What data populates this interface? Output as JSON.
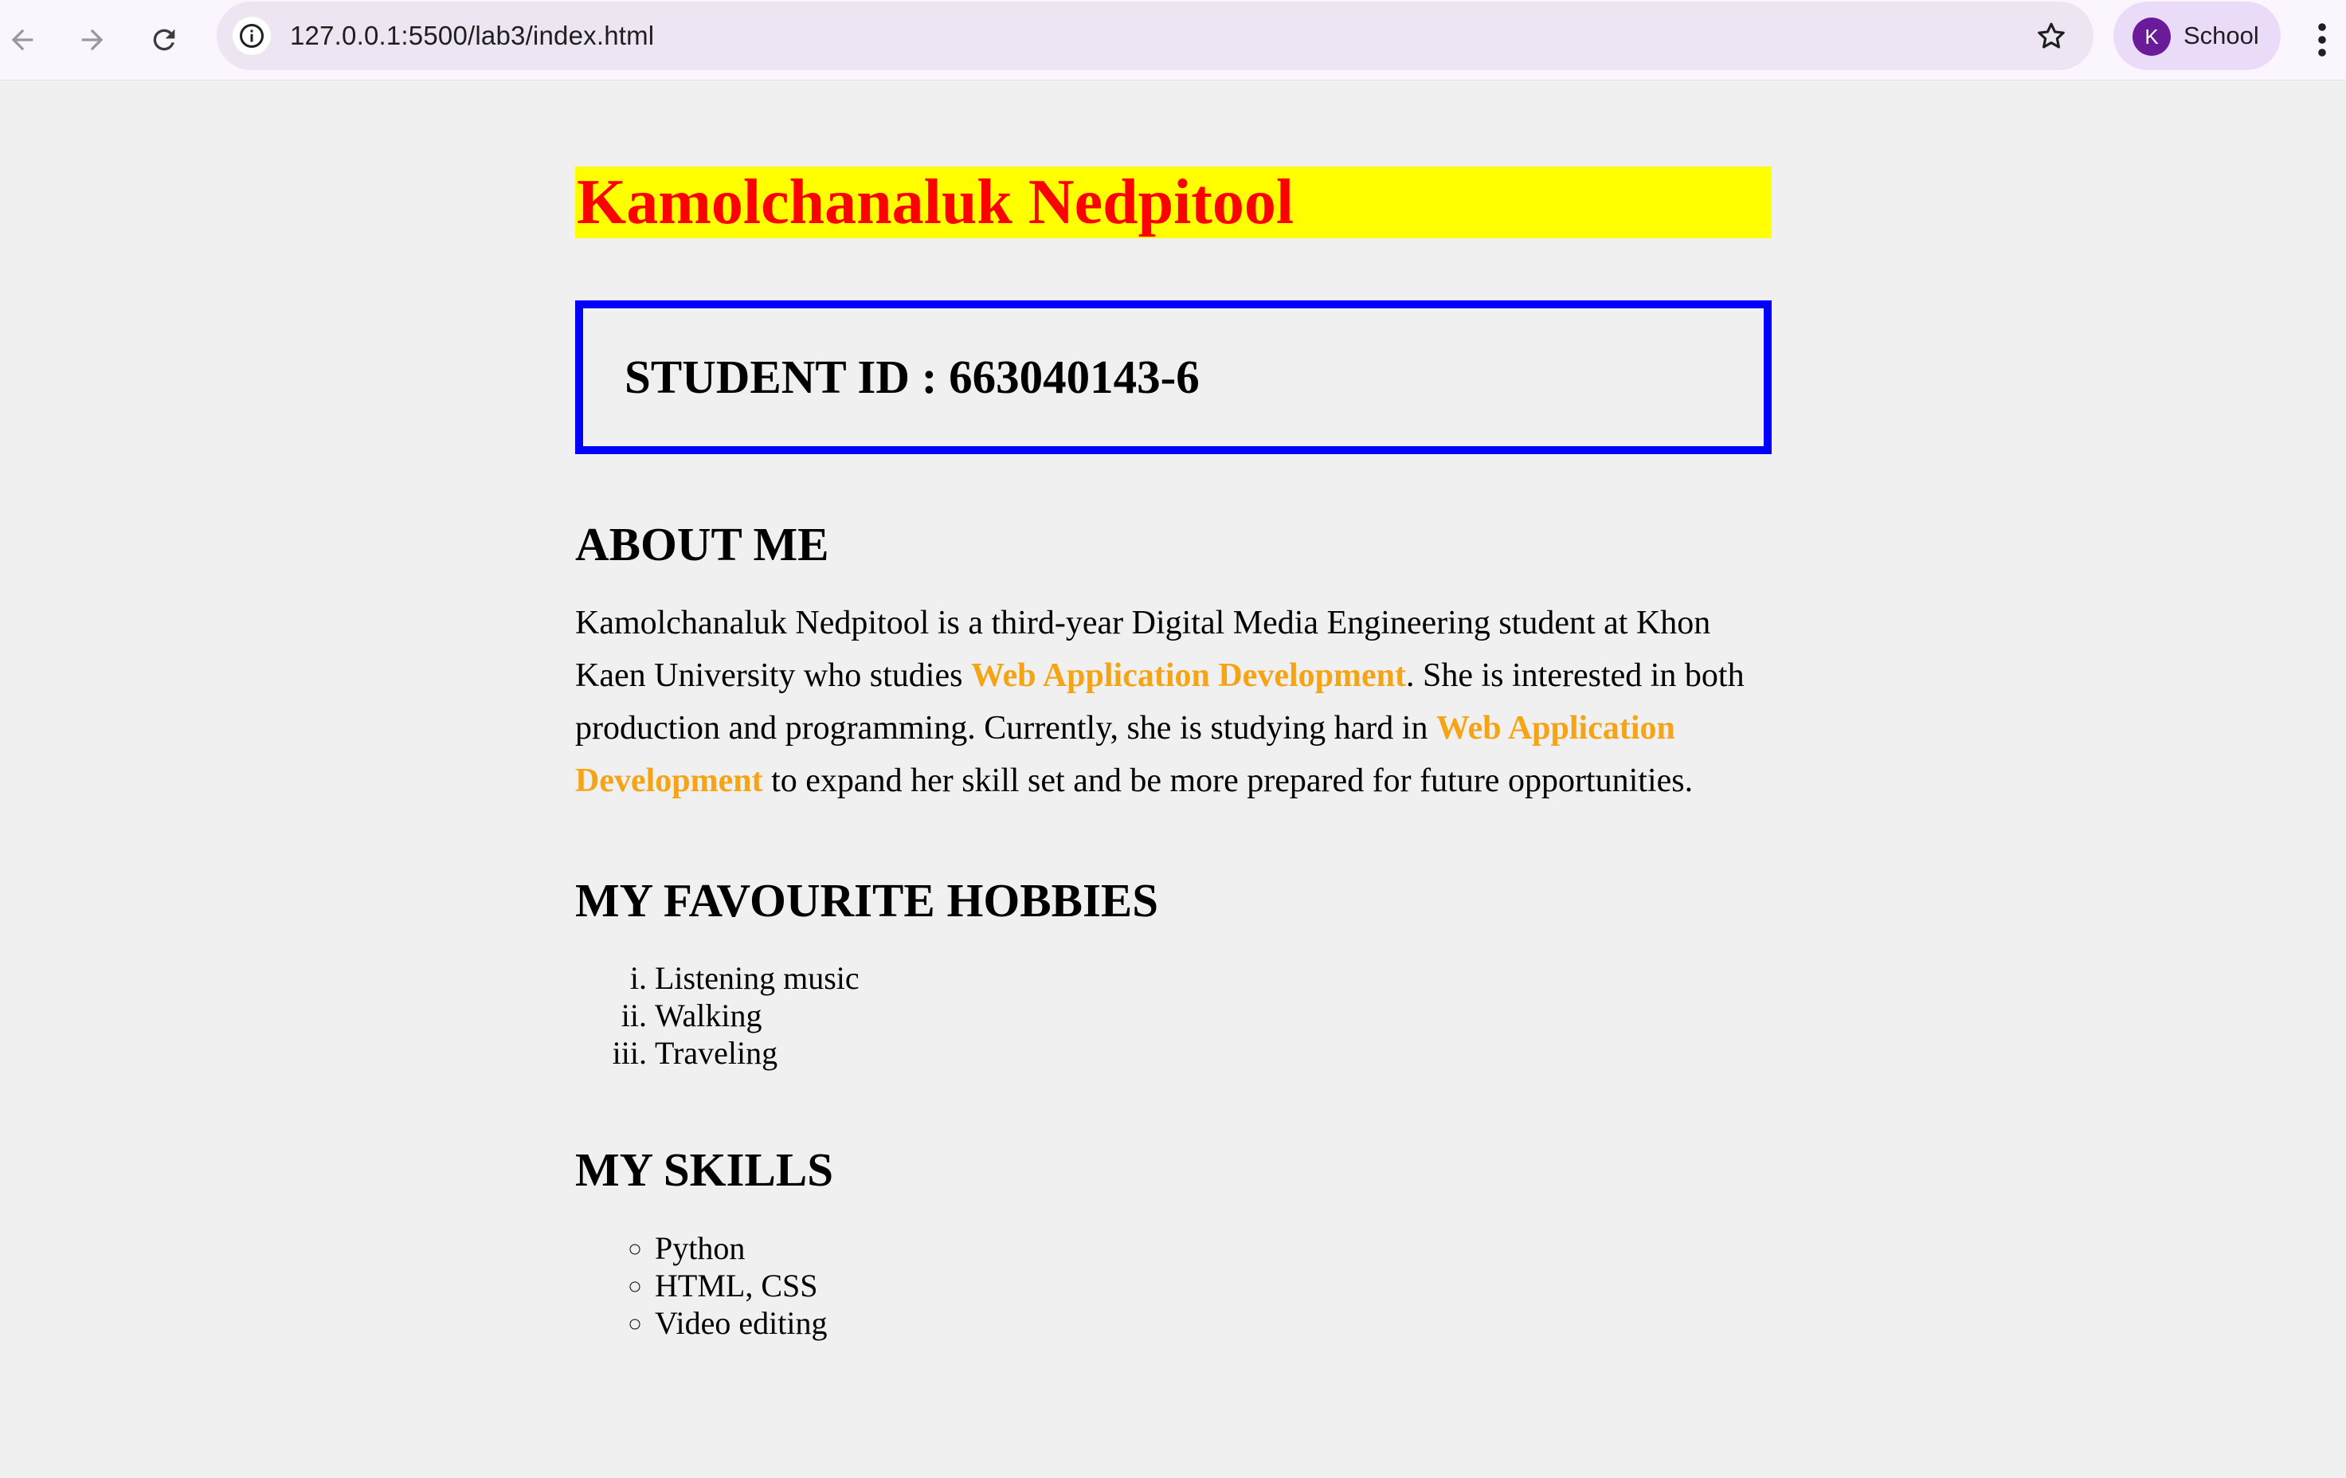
{
  "browser": {
    "url": "127.0.0.1:5500/lab3/index.html",
    "profile_initial": "K",
    "profile_name": "School",
    "icons": {
      "back": "arrow-left-icon",
      "forward": "arrow-right-icon",
      "reload": "reload-icon",
      "site_info": "info-icon",
      "bookmark": "star-icon",
      "menu": "kebab-menu-icon"
    }
  },
  "page": {
    "name": "Kamolchanaluk Nedpitool",
    "student_id": "STUDENT ID : 663040143-6",
    "about": {
      "heading": "ABOUT ME",
      "p1": "Kamolchanaluk Nedpitool is a third-year Digital Media Engineering student at Khon Kaen University who studies ",
      "hl1": "Web Application Development",
      "p2": ". She is interested in both production and programming. Currently, she is studying hard in ",
      "hl2": "Web Application Development",
      "p3": " to expand her skill set and be more prepared for future opportunities."
    },
    "hobbies": {
      "heading": "MY FAVOURITE HOBBIES",
      "items": [
        "Listening music",
        "Walking",
        "Traveling"
      ]
    },
    "skills": {
      "heading": "MY SKILLS",
      "items": [
        "Python",
        "HTML, CSS",
        "Video editing"
      ]
    }
  },
  "colors": {
    "name_bg": "#ffff00",
    "name_text": "#ff0000",
    "id_border": "#0000ff",
    "highlight": "#f5a416",
    "avatar_bg": "#6a1b9a"
  }
}
